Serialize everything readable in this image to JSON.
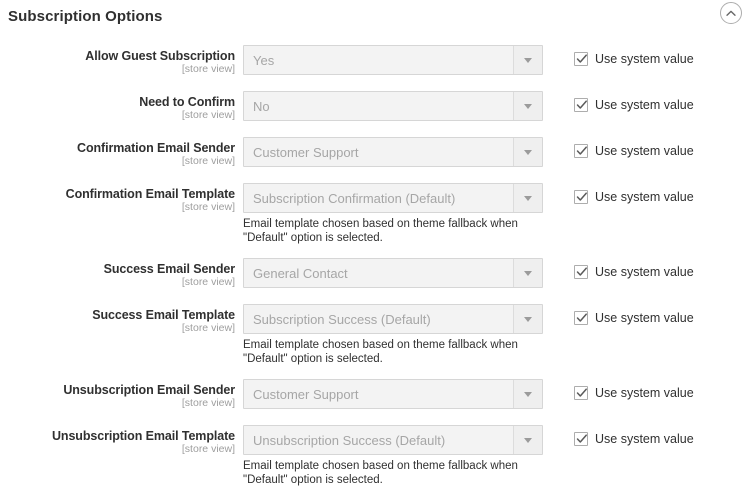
{
  "section": {
    "title": "Subscription Options",
    "collapse_icon": "chevron-up-circle-icon"
  },
  "common": {
    "scope": "[store view]",
    "system_value_label": "Use system value",
    "template_note": "Email template chosen based on theme fallback when \"Default\" option is selected.",
    "dropdown_icon": "chevron-down-icon",
    "check_icon": "check-icon"
  },
  "colors": {
    "text": "#303030",
    "muted": "#9e9e9e",
    "field_bg": "#f3f3f3",
    "field_border": "#d6d6d6",
    "placeholder": "#a6a6a6"
  },
  "rows": [
    {
      "label": "Allow Guest Subscription",
      "scope": "[store view]",
      "value": "Yes",
      "note": null,
      "use_system_value": true,
      "system_value_label": "Use system value"
    },
    {
      "label": "Need to Confirm",
      "scope": "[store view]",
      "value": "No",
      "note": null,
      "use_system_value": true,
      "system_value_label": "Use system value"
    },
    {
      "label": "Confirmation Email Sender",
      "scope": "[store view]",
      "value": "Customer Support",
      "note": null,
      "use_system_value": true,
      "system_value_label": "Use system value"
    },
    {
      "label": "Confirmation Email Template",
      "scope": "[store view]",
      "value": "Subscription Confirmation (Default)",
      "note": "Email template chosen based on theme fallback when \"Default\" option is selected.",
      "use_system_value": true,
      "system_value_label": "Use system value"
    },
    {
      "label": "Success Email Sender",
      "scope": "[store view]",
      "value": "General Contact",
      "note": null,
      "use_system_value": true,
      "system_value_label": "Use system value"
    },
    {
      "label": "Success Email Template",
      "scope": "[store view]",
      "value": "Subscription Success (Default)",
      "note": "Email template chosen based on theme fallback when \"Default\" option is selected.",
      "use_system_value": true,
      "system_value_label": "Use system value"
    },
    {
      "label": "Unsubscription Email Sender",
      "scope": "[store view]",
      "value": "Customer Support",
      "note": null,
      "use_system_value": true,
      "system_value_label": "Use system value"
    },
    {
      "label": "Unsubscription Email Template",
      "scope": "[store view]",
      "value": "Unsubscription Success (Default)",
      "note": "Email template chosen based on theme fallback when \"Default\" option is selected.",
      "use_system_value": true,
      "system_value_label": "Use system value"
    }
  ]
}
